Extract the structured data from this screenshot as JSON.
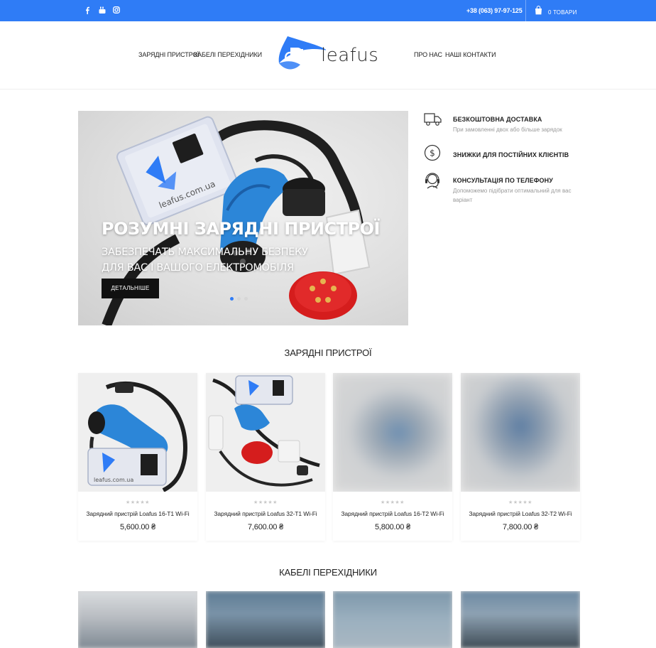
{
  "topbar": {
    "social_icons": [
      "facebook-icon",
      "youtube-icon",
      "instagram-icon"
    ],
    "phone": "+38 (063) 97-97-125",
    "cart_label": "0 ТОВАРИ",
    "bg_color": "#2f7cf6"
  },
  "header": {
    "nav_left": [
      "ЗАРЯДНІ ПРИСТРОЇ",
      "КАБЕЛІ ПЕРЕХІДНИКИ"
    ],
    "nav_right": [
      "ПРО НАС",
      "НАШІ КОНТАКТИ"
    ],
    "logo_text": "leafus"
  },
  "hero": {
    "title": "РОЗУМНІ ЗАРЯДНІ ПРИСТРОЇ",
    "subtitle": "ЗАБЕЗПЕЧАТЬ МАКСИМАЛЬНУ БЕЗПЕКУ ДЛЯ ВАС І ВАШОГО ЕЛЕКТРОМОБІЛЯ",
    "button_label": "ДЕТАЛЬНІШЕ",
    "device_label": "leafus.com.ua",
    "slides": 3,
    "active_slide": 1
  },
  "features": [
    {
      "icon": "truck-icon",
      "title": "БЕЗКОШТОВНА ДОСТАВКА",
      "desc": "При замовленні двох або більше зарядок"
    },
    {
      "icon": "dollar-icon",
      "title": "ЗНИЖКИ ДЛЯ ПОСТІЙНИХ КЛІЄНТІВ",
      "desc": ""
    },
    {
      "icon": "headset-icon",
      "title": "КОНСУЛЬТАЦІЯ ПО ТЕЛЕФОНУ",
      "desc": "Допоможемо підібрати оптимальний для вас варіант"
    }
  ],
  "sections": {
    "chargers_title": "ЗАРЯДНІ ПРИСТРОЇ",
    "cables_title": "КАБЕЛІ ПЕРЕХІДНИКИ"
  },
  "products": [
    {
      "name": "Зарядний пристрій Loafus 16-T1 Wi-Fi",
      "price": "5,600.00 ₴",
      "stars": "★★★★★"
    },
    {
      "name": "Зарядний пристрій Loafus 32-T1 Wi-Fi",
      "price": "7,600.00 ₴",
      "stars": "★★★★★"
    },
    {
      "name": "Зарядний пристрій Loafus 16-T2 Wi-Fi",
      "price": "5,800.00 ₴",
      "stars": "★★★★★"
    },
    {
      "name": "Зарядний пристрій Loafus 32-T2 Wi-Fi",
      "price": "7,800.00 ₴",
      "stars": "★★★★★"
    }
  ]
}
